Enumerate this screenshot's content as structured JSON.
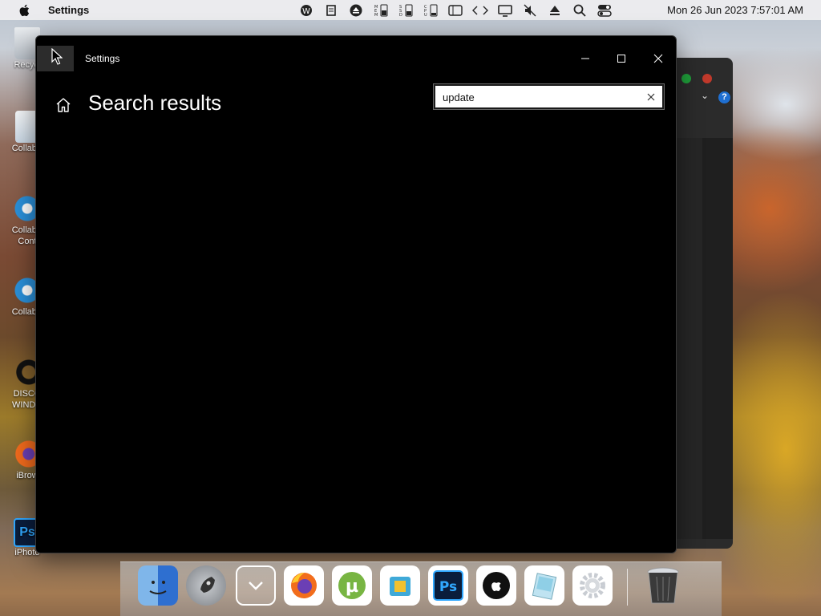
{
  "menubar": {
    "app_name": "Settings",
    "clock": "Mon 26 Jun 2023  7:57:01 AM",
    "status_icons": [
      "app-icon",
      "clipboard-icon",
      "eject-icon",
      "mem-icon",
      "ssd-icon",
      "cpu-icon",
      "window-icon",
      "code-icon",
      "display-icon",
      "mute-icon",
      "eject-icon",
      "search-icon",
      "control-center-icon"
    ]
  },
  "desktop": {
    "icons": [
      {
        "name": "desktop-icon-recycle",
        "label": "Recycl"
      },
      {
        "name": "desktop-icon-collab-1",
        "label": "CollabS"
      },
      {
        "name": "desktop-icon-collab-contact",
        "label": "CollabS Cont"
      },
      {
        "name": "desktop-icon-collab-2",
        "label": "CollabS"
      },
      {
        "name": "desktop-icon-disco",
        "label": "DISCO WINDO"
      },
      {
        "name": "desktop-icon-ibrowser",
        "label": "iBrow"
      },
      {
        "name": "desktop-icon-iphoto",
        "label": "iPhoto"
      }
    ]
  },
  "settings": {
    "window_title": "Settings",
    "page_title": "Search results",
    "search": {
      "value": "update",
      "placeholder": ""
    }
  },
  "dock": {
    "items": [
      "finder",
      "launchpad",
      "downloads",
      "firefox",
      "utorrent",
      "archive",
      "photoshop",
      "itunes",
      "preview",
      "system-preferences",
      "trash"
    ]
  }
}
